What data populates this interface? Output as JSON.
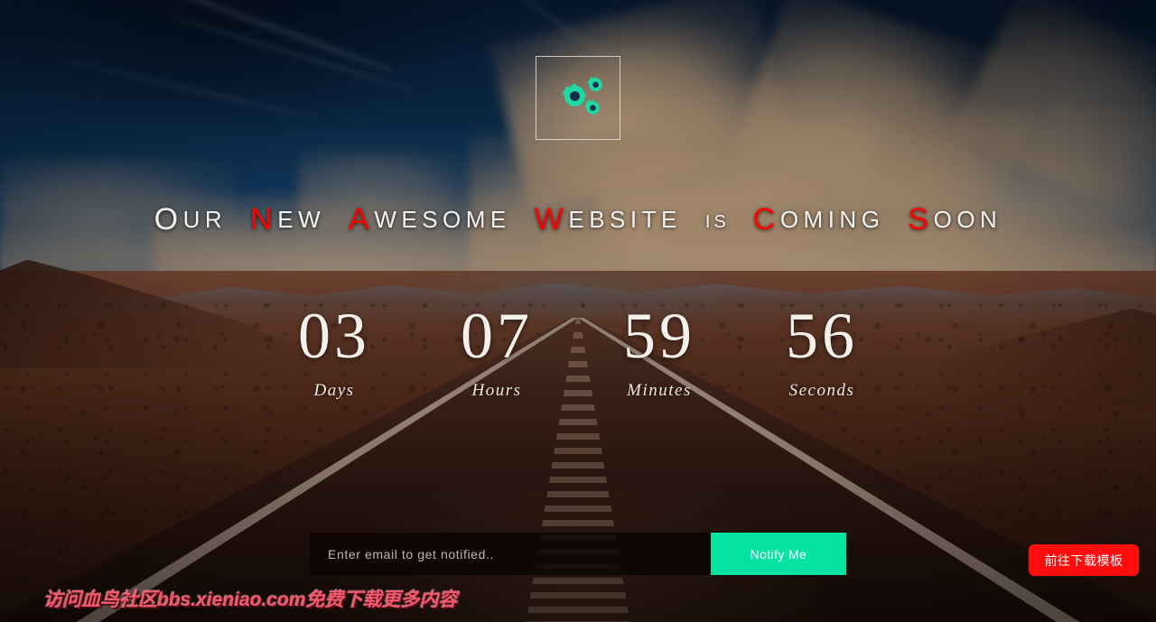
{
  "page": {
    "logo": {
      "icon": "gears-icon",
      "alt": "gears-logo"
    },
    "headline": {
      "full_text": "Our New Awesome Website is Coming Soon",
      "words": [
        {
          "cap": "O",
          "rest": "UR",
          "cap_color": "#f2f2f2"
        },
        {
          "cap": "N",
          "rest": "EW",
          "cap_color": "#ff0000"
        },
        {
          "cap": "A",
          "rest": "WESOME",
          "cap_color": "#ff0000"
        },
        {
          "cap": "W",
          "rest": "EBSITE",
          "cap_color": "#ff0000"
        },
        {
          "cap": "I",
          "rest": "S",
          "cap_color": "#f2f2f2",
          "small": true
        },
        {
          "cap": "C",
          "rest": "OMING",
          "cap_color": "#ff0000"
        },
        {
          "cap": "S",
          "rest": "OON",
          "cap_color": "#ff0000"
        }
      ]
    },
    "countdown": [
      {
        "value": "03",
        "label": "Days"
      },
      {
        "value": "07",
        "label": "Hours"
      },
      {
        "value": "59",
        "label": "Minutes"
      },
      {
        "value": "56",
        "label": "Seconds"
      }
    ],
    "subscribe": {
      "email_placeholder": "Enter email to get notified..",
      "email_value": "",
      "notify_label": "Notify Me",
      "notify_color": "#05e3a2"
    },
    "download_button": {
      "label": "前往下载模板",
      "color": "#ff0c0c"
    },
    "watermark": {
      "text": "访问血鸟社区bbs.xieniao.com免费下载更多内容",
      "color": "#f05a6e"
    },
    "theme": {
      "accent_teal": "#05e3a2",
      "accent_red": "#ff0000",
      "text_light": "#f2f2f2",
      "sky_dark": "#071a33",
      "ground_brown": "#4a2718"
    }
  }
}
